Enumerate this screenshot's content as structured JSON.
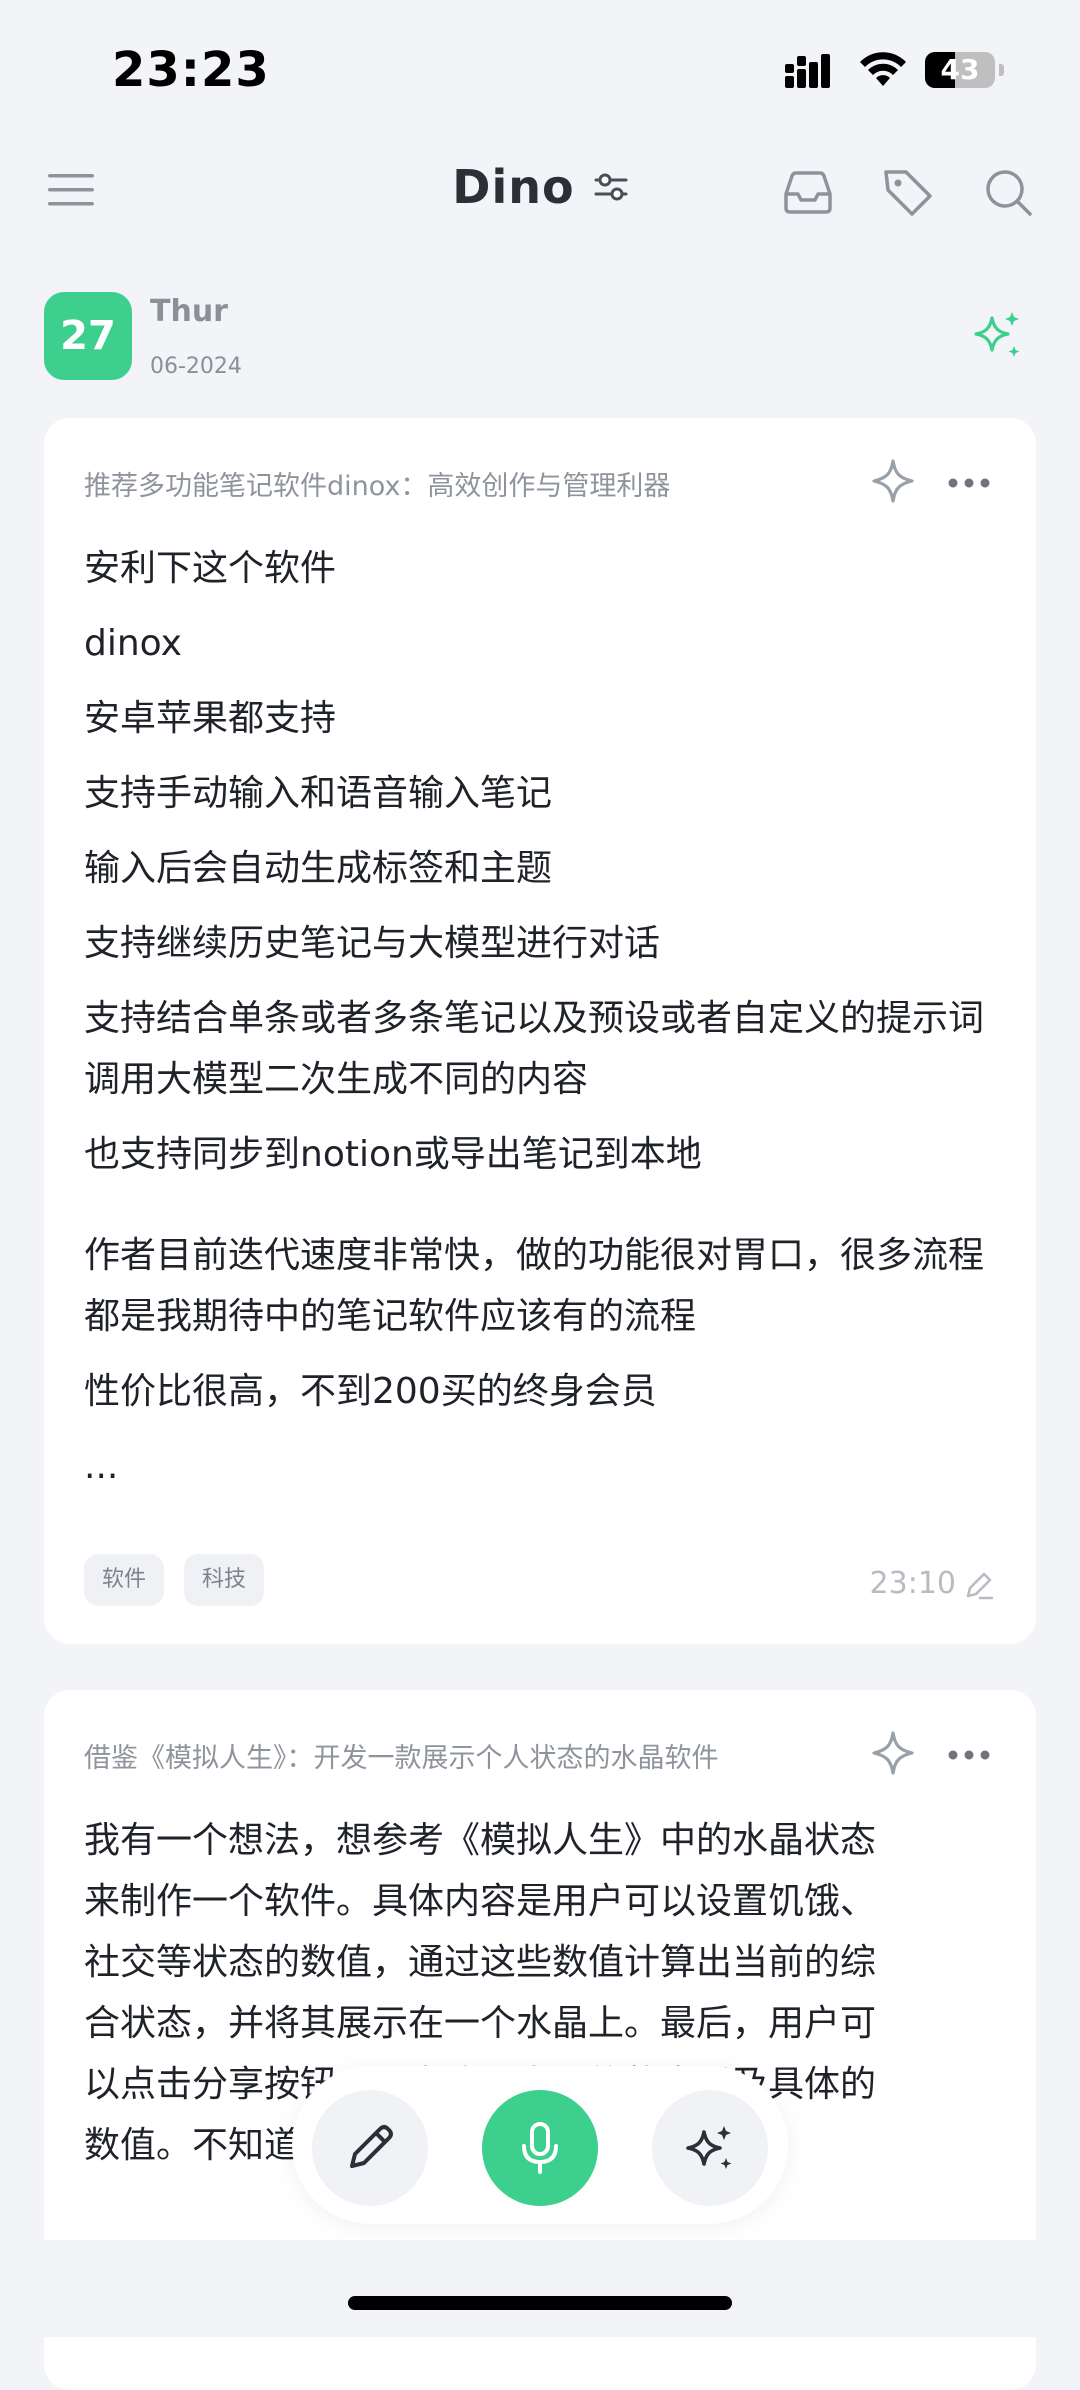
{
  "status_bar": {
    "time": "23:23",
    "battery": "43",
    "battery_level": 0.43
  },
  "header": {
    "title": "Dino",
    "icons": [
      "menu-icon",
      "filter-icon",
      "inbox-icon",
      "tag-icon",
      "search-icon"
    ]
  },
  "date": {
    "day": "27",
    "weekday": "Thur",
    "month_year": "06-2024"
  },
  "notes": [
    {
      "title": "推荐多功能笔记软件dinox：高效创作与管理利器",
      "lines": [
        "安利下这个软件",
        "dinox",
        "安卓苹果都支持",
        "支持手动输入和语音输入笔记",
        "输入后会自动生成标签和主题",
        "支持继续历史笔记与大模型进行对话",
        "支持结合单条或者多条笔记以及预设或者自定义的提示词调用大模型二次生成不同的内容",
        "也支持同步到notion或导出笔记到本地",
        "作者目前迭代速度非常快，做的功能很对胃口，很多流程都是我期待中的笔记软件应该有的流程",
        "性价比很高，不到200买的终身会员",
        "..."
      ],
      "tags": [
        "软件",
        "科技"
      ],
      "time": "23:10"
    },
    {
      "title": "借鉴《模拟人生》：开发一款展示个人状态的水晶软件",
      "lines": [
        "我有一个想法，想参考《模拟人生》中的水晶状态",
        "来制作一个软件。具体内容是用户可以设置饥饿、",
        "社交等状态的数值，通过这些数值计算出当前的综",
        "合状态，并将其展示在一个水晶上。最后，用户可",
        "以点击分享按钮，分享这个水晶的状态以及具体的",
        "数值。不知道这个想法是否可行或者有用？"
      ]
    }
  ],
  "colors": {
    "accent": "#3ccf8e",
    "background": "#f3f4f7",
    "card": "#ffffff"
  }
}
